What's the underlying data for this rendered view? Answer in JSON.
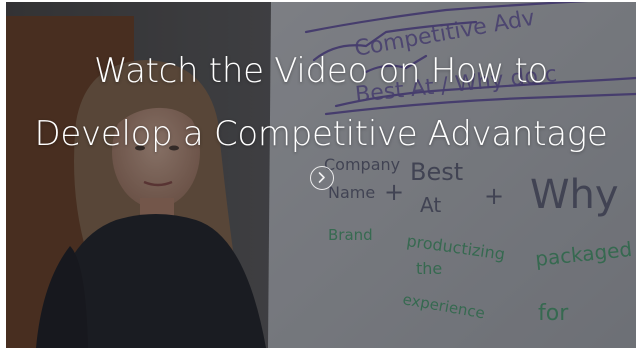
{
  "video": {
    "title_line_1": "Watch the Video on How to",
    "title_line_2": "Develop a Competitive Advantage",
    "play_icon": "chevron-right-icon"
  },
  "whiteboard": {
    "line_1": "Competitive Adv",
    "line_2": "Best At / Why do c",
    "word_company": "Company",
    "word_name": "Name",
    "word_plus_1": "+",
    "word_best": "Best",
    "word_at": "At",
    "word_plus_2": "+",
    "word_why": "Why",
    "word_green_1": "Brand",
    "word_green_2": "productizing",
    "word_green_3": "the",
    "word_green_4": "experience",
    "word_green_5": "packaged",
    "word_green_6": "for"
  },
  "colors": {
    "overlay": "#141620",
    "title_text": "#ffffff",
    "marker_purple": "#6b5aa8",
    "marker_green": "#3fa36a"
  }
}
